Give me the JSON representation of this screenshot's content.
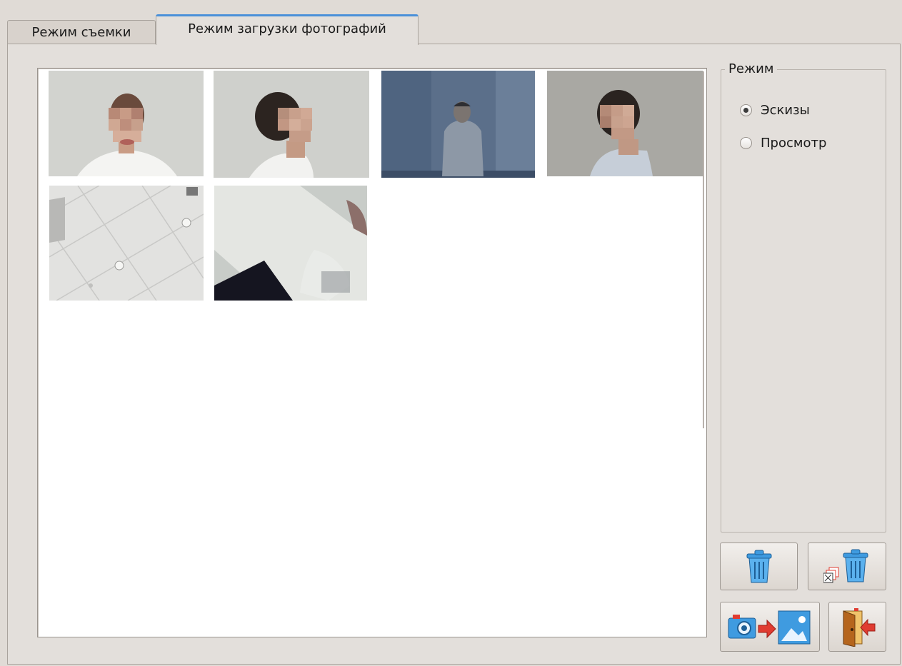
{
  "tabs": [
    {
      "label": "Режим съемки",
      "active": false
    },
    {
      "label": "Режим загрузки фотографий",
      "active": true
    }
  ],
  "mode_group": {
    "title": "Режим",
    "options": [
      {
        "label": "Эскизы",
        "selected": true
      },
      {
        "label": "Просмотр",
        "selected": false
      }
    ]
  },
  "thumbnails": [
    {
      "name": "photo-frontal-portrait"
    },
    {
      "name": "photo-profile-left"
    },
    {
      "name": "photo-full-height"
    },
    {
      "name": "photo-profile-right"
    },
    {
      "name": "photo-ceiling"
    },
    {
      "name": "photo-blurred"
    }
  ],
  "buttons": [
    {
      "name": "delete-button",
      "icon": "trash-icon"
    },
    {
      "name": "delete-all-button",
      "icon": "delete-all-icon"
    },
    {
      "name": "camera-to-image-button",
      "icon": "camera-to-image-icon"
    },
    {
      "name": "exit-button",
      "icon": "exit-door-icon"
    }
  ],
  "colors": {
    "accent": "#4a90d9",
    "background": "#e3dfdb",
    "trash_blue": "#3f9be0",
    "arrow_red": "#e03c31"
  }
}
